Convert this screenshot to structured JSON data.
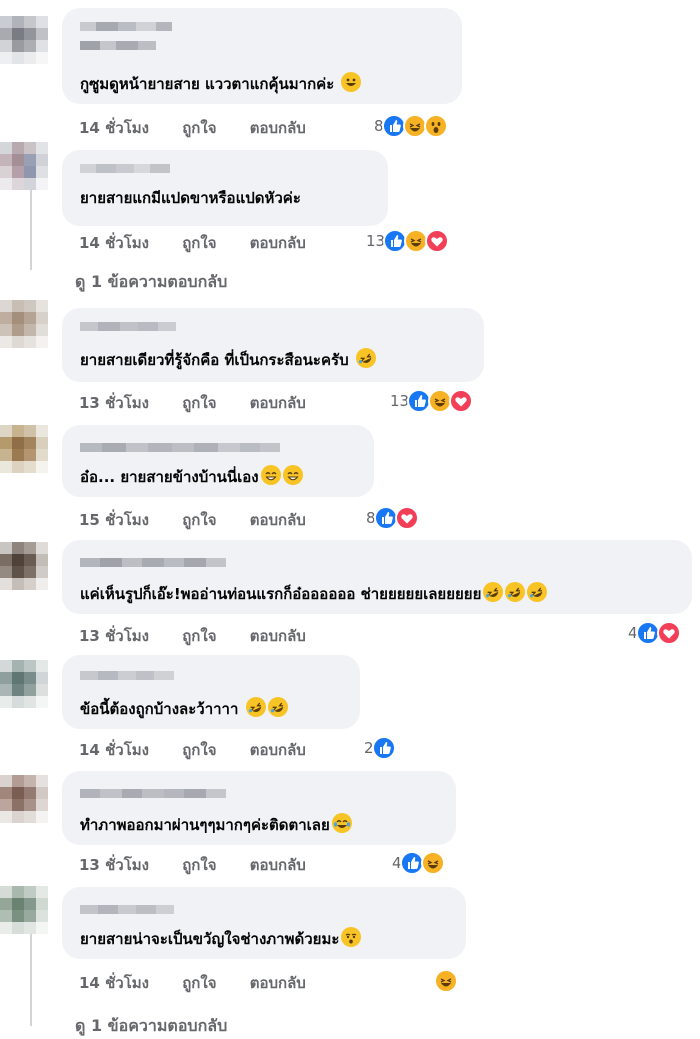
{
  "actions": {
    "like_label": "ถูกใจ",
    "reply_label": "ตอบกลับ"
  },
  "comments": [
    {
      "text": "กูซูมดูหน้ายายสาย แววตาแกคุ้นมากค่ะ",
      "time": "14 ชั่วโมง",
      "reaction_count": "8",
      "reactions": [
        "like-icon",
        "haha-icon",
        "wow-icon"
      ],
      "inline_emoji": [
        "grinning-emoji"
      ]
    },
    {
      "text": "ยายสายแกมีแปดขาหรือแปดหัวค่ะ",
      "time": "14 ชั่วโมง",
      "reaction_count": "13",
      "reactions": [
        "like-icon",
        "haha-icon",
        "love-icon"
      ],
      "inline_emoji": []
    },
    {
      "text": "ยายสายเดียวที่รู้จักคือ ที่เป็นกระสือนะครับ",
      "time": "13 ชั่วโมง",
      "reaction_count": "13",
      "reactions": [
        "like-icon",
        "haha-icon",
        "love-icon"
      ],
      "inline_emoji": [
        "rolling-laughing-emoji"
      ]
    },
    {
      "text": "อ๋อ... ยายสายข้างบ้านนี่เอง",
      "time": "15 ชั่วโมง",
      "reaction_count": "8",
      "reactions": [
        "like-icon",
        "love-icon"
      ],
      "inline_emoji": [
        "smiling-eyes-emoji",
        "smiling-eyes-emoji"
      ]
    },
    {
      "text": "แค่เห็นรูปก็เอ๊ะ!พออ่านท่อนแรกก็อ๋ออออออ ช่ายยยยยเลยยยยย",
      "time": "13 ชั่วโมง",
      "reaction_count": "4",
      "reactions": [
        "like-icon",
        "love-icon"
      ],
      "inline_emoji": [
        "rolling-laughing-emoji",
        "rolling-laughing-emoji",
        "rolling-laughing-emoji"
      ]
    },
    {
      "text": "ข้อนี้ต้องถูกบ้างละว้าาาา",
      "time": "14 ชั่วโมง",
      "reaction_count": "2",
      "reactions": [
        "like-icon"
      ],
      "inline_emoji": [
        "rolling-laughing-emoji",
        "rolling-laughing-emoji"
      ]
    },
    {
      "text": "ทำภาพออกมาผ่านๆๆมากๆค่ะติดตาเลย",
      "time": "13 ชั่วโมง",
      "reaction_count": "4",
      "reactions": [
        "like-icon",
        "haha-icon"
      ],
      "inline_emoji": [
        "tears-of-joy-emoji"
      ]
    },
    {
      "text": "ยายสายน่าจะเป็นขวัญใจช่างภาพด้วยมะ",
      "time": "14 ชั่วโมง",
      "reaction_count": "",
      "reactions": [
        "haha-icon"
      ],
      "inline_emoji": [
        "hushed-emoji"
      ]
    }
  ],
  "view_replies": [
    {
      "label": "ดู 1 ข้อความตอบกลับ"
    },
    {
      "label": "ดู 1 ข้อความตอบกลับ"
    }
  ],
  "colors": {
    "bubble": "#f0f2f5",
    "meta_text": "#65676b",
    "like": "#1877f2",
    "haha": "#f7b125",
    "love": "#f33e58"
  }
}
